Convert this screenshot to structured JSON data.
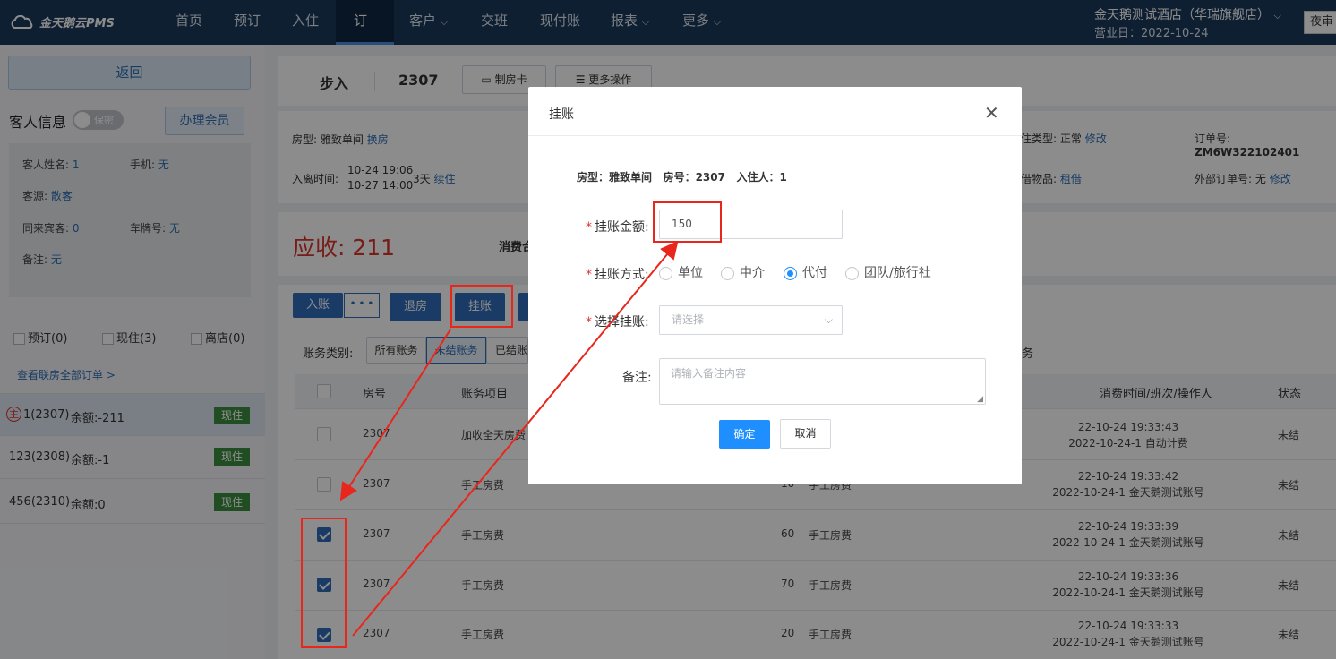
{
  "nav": {
    "logo": "金天鹅云PMS",
    "items": [
      {
        "label": "首页"
      },
      {
        "label": "预订"
      },
      {
        "label": "入住"
      },
      {
        "label": "订单"
      },
      {
        "label": "客户"
      },
      {
        "label": "交班"
      },
      {
        "label": "现付账"
      },
      {
        "label": "报表"
      },
      {
        "label": "更多"
      }
    ],
    "hotel": "金天鹅测试酒店（华瑞旗舰店）",
    "bizdate": "营业日：2022-10-24",
    "night": "夜审"
  },
  "left": {
    "back": "返回",
    "guest_title": "客人信息",
    "privacy": "保密",
    "member_btn": "办理会员",
    "name_label": "客人姓名:",
    "name_val": "1",
    "phone_label": "手机:",
    "phone_val": "无",
    "source_label": "客源:",
    "source_val": "散客",
    "companion_label": "同来宾客:",
    "companion_val": "0",
    "plate_label": "车牌号:",
    "plate_val": "无",
    "remark_label": "备注:",
    "remark_val": "无",
    "filters": [
      "预订(0)",
      "现住(3)",
      "离店(0)"
    ],
    "view_all": "查看联房全部订单 >",
    "orders": [
      {
        "main_icon": "主",
        "name": "1(2307)",
        "balance": "余额:-211",
        "status": "现住"
      },
      {
        "name": "123(2308)",
        "balance": "余额:-1",
        "status": "现住"
      },
      {
        "name": "456(2310)",
        "balance": "余额:0",
        "status": "现住"
      }
    ]
  },
  "main": {
    "walkin": "步入",
    "room_no": "2307",
    "card_btn": "制房卡",
    "more_btn": "更多操作",
    "roomtype_label": "房型:",
    "roomtype_val": "雅致单间",
    "change_room": "换房",
    "stay_label": "入离时间:",
    "stay_in": "10-24 19:06",
    "stay_out": "10-27 14:00",
    "nights": "3天",
    "extend": "续住",
    "pricetype_label": "住类型:",
    "pricetype_val": "正常",
    "modify": "修改",
    "orderno_label": "订单号:",
    "orderno_val": "ZM6W322102401",
    "rent_label": "借物品:",
    "rent_val": "租借",
    "extorder_label": "外部订单号:",
    "extorder_val": "无",
    "modify2": "修改",
    "due": "应收: 211",
    "consume": "消费合",
    "btn_post": "入账",
    "btn_more": "• • •",
    "btn_checkout": "退房",
    "btn_credit": "挂账",
    "acct_type_label": "账务类别:",
    "acct_tabs": [
      "所有账务",
      "未结账务",
      "已结账"
    ],
    "tail_text": "务",
    "headers": {
      "room": "房号",
      "item": "账务项目",
      "time": "消费时间/班次/操作人",
      "status": "状态"
    },
    "rows": [
      {
        "room": "2307",
        "item": "加收全天房费",
        "amount": "",
        "desc": "",
        "time": "22-10-24 19:33:43",
        "shift": "2022-10-24-1 自动计费",
        "status": "未结",
        "checked": false
      },
      {
        "room": "2307",
        "item": "手工房费",
        "amount": "10",
        "desc": "手工房费",
        "time": "22-10-24 19:33:42",
        "shift": "2022-10-24-1 金天鹅测试账号",
        "status": "未结",
        "checked": false
      },
      {
        "room": "2307",
        "item": "手工房费",
        "amount": "60",
        "desc": "手工房费",
        "time": "22-10-24 19:33:39",
        "shift": "2022-10-24-1 金天鹅测试账号",
        "status": "未结",
        "checked": true
      },
      {
        "room": "2307",
        "item": "手工房费",
        "amount": "70",
        "desc": "手工房费",
        "time": "22-10-24 19:33:36",
        "shift": "2022-10-24-1 金天鹅测试账号",
        "status": "未结",
        "checked": true
      },
      {
        "room": "2307",
        "item": "手工房费",
        "amount": "20",
        "desc": "手工房费",
        "time": "22-10-24 19:33:33",
        "shift": "2022-10-24-1 金天鹅测试账号",
        "status": "未结",
        "checked": true
      }
    ]
  },
  "dialog": {
    "title": "挂账",
    "info_roomtype": "房型：雅致单间",
    "info_room": "房号：2307",
    "info_guest": "入住人：1",
    "amount_label": "挂账金额:",
    "amount_value": "150",
    "method_label": "挂账方式:",
    "methods": [
      "单位",
      "中介",
      "代付",
      "团队/旅行社"
    ],
    "selected_method": "代付",
    "select_label": "选择挂账:",
    "select_placeholder": "请选择",
    "remark_label": "备注:",
    "remark_placeholder": "请输入备注内容",
    "confirm": "确定",
    "cancel": "取消"
  },
  "colors": {
    "nav_bg": "#1d3a5c",
    "primary": "#2e6cb8",
    "due": "#d9342b",
    "annotation": "#e8261c",
    "status_green": "#3b8e3f"
  }
}
